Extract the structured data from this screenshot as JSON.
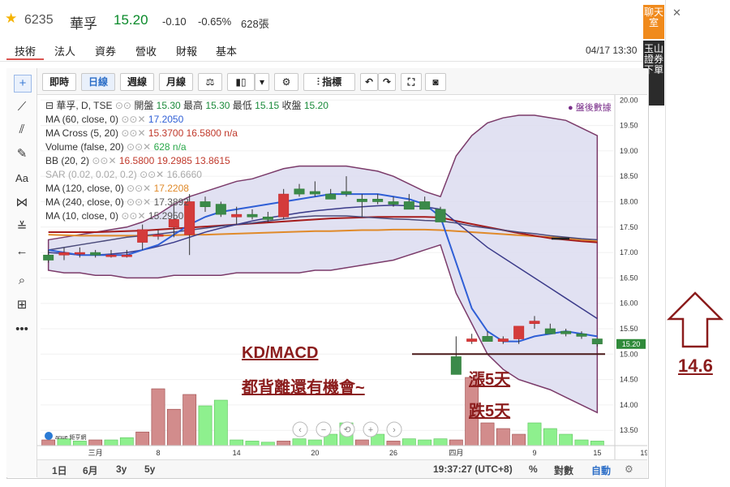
{
  "header": {
    "star_icon": "star-icon",
    "code": "6235",
    "name": "華孚",
    "price": "15.20",
    "change": "-0.10",
    "change_pct": "-0.65%",
    "volume": "628張",
    "datetime": "04/17 13:30",
    "tabs": [
      "技術",
      "法人",
      "資券",
      "營收",
      "財報",
      "基本"
    ]
  },
  "toolbar": {
    "intraday": "即時",
    "daily": "日線",
    "weekly": "週線",
    "monthly": "月線",
    "indicators": "指標"
  },
  "legend": {
    "title": "華孚, D, TSE",
    "open_label": "開盤",
    "open": "15.30",
    "high_label": "最高",
    "high": "15.30",
    "low_label": "最低",
    "low": "15.15",
    "close_label": "收盤",
    "close": "15.20",
    "after_hours": "● 盤後數據",
    "rows": [
      {
        "label": "MA (60, close, 0)",
        "values": "17.2050"
      },
      {
        "label": "MA Cross (5, 20)",
        "values": "15.3700  16.5800  n/a"
      },
      {
        "label": "Volume (false, 20)",
        "values": "628  n/a"
      },
      {
        "label": "BB (20, 2)",
        "values": "16.5800  19.2985  13.8615"
      },
      {
        "label": "SAR (0.02, 0.02, 0.2)",
        "values": "16.6660"
      },
      {
        "label": "MA (120, close, 0)",
        "values": "17.2208"
      },
      {
        "label": "MA (240, close, 0)",
        "values": "17.3892"
      },
      {
        "label": "MA (10, close, 0)",
        "values": "15.2950"
      }
    ]
  },
  "annotations": {
    "kd_macd": "KD/MACD",
    "divergence": "都背離還有機會~",
    "up5": "漲5天",
    "down5": "跌5天",
    "target": "14.6",
    "last_price_tag": "15.20",
    "nav_buttons": [
      "‹",
      "−",
      "⟲",
      "+",
      "›"
    ],
    "logo_text": "anue 鉅亨網"
  },
  "sidebar": {
    "chatroom": "聊天室",
    "trade": "玉山證券下單",
    "close": "✕"
  },
  "bottom_bar": {
    "ranges": [
      "1日",
      "6月",
      "3y",
      "5y"
    ],
    "time": "19:37:27 (UTC+8)",
    "percent": "%",
    "log": "對數",
    "auto": "自動"
  },
  "chart_data": {
    "type": "candlestick",
    "y_ticks": [
      13.5,
      14.0,
      14.5,
      15.0,
      15.5,
      16.0,
      16.5,
      17.0,
      17.5,
      18.0,
      18.5,
      19.0,
      19.5,
      20.0
    ],
    "ylim": [
      13.2,
      20.1
    ],
    "x_ticks": [
      "三月",
      "8",
      "14",
      "20",
      "26",
      "四月",
      "9",
      "15",
      "19"
    ],
    "candles": [
      {
        "o": 16.95,
        "h": 17.05,
        "l": 16.8,
        "c": 16.85
      },
      {
        "o": 16.95,
        "h": 17.1,
        "l": 16.85,
        "c": 17.0
      },
      {
        "o": 17.0,
        "h": 17.1,
        "l": 16.9,
        "c": 17.0
      },
      {
        "o": 17.0,
        "h": 17.05,
        "l": 16.9,
        "c": 16.95
      },
      {
        "o": 16.95,
        "h": 17.05,
        "l": 16.9,
        "c": 16.95
      },
      {
        "o": 16.95,
        "h": 17.05,
        "l": 16.9,
        "c": 16.95
      },
      {
        "o": 17.2,
        "h": 17.55,
        "l": 17.05,
        "c": 17.45
      },
      {
        "o": 17.35,
        "h": 17.45,
        "l": 17.25,
        "c": 17.35
      },
      {
        "o": 17.5,
        "h": 17.95,
        "l": 17.3,
        "c": 17.65
      },
      {
        "o": 17.35,
        "h": 18.15,
        "l": 16.95,
        "c": 18.0
      },
      {
        "o": 18.0,
        "h": 18.1,
        "l": 17.8,
        "c": 17.9
      },
      {
        "o": 17.95,
        "h": 18.0,
        "l": 17.7,
        "c": 17.75
      },
      {
        "o": 17.7,
        "h": 17.9,
        "l": 17.55,
        "c": 17.75
      },
      {
        "o": 17.75,
        "h": 17.85,
        "l": 17.65,
        "c": 17.7
      },
      {
        "o": 17.7,
        "h": 17.8,
        "l": 17.6,
        "c": 17.65
      },
      {
        "o": 17.7,
        "h": 18.25,
        "l": 17.65,
        "c": 18.15
      },
      {
        "o": 18.25,
        "h": 18.35,
        "l": 18.1,
        "c": 18.15
      },
      {
        "o": 18.2,
        "h": 18.4,
        "l": 18.1,
        "c": 18.15
      },
      {
        "o": 18.15,
        "h": 18.25,
        "l": 18.05,
        "c": 18.05
      },
      {
        "o": 18.2,
        "h": 18.5,
        "l": 18.1,
        "c": 18.15
      },
      {
        "o": 18.05,
        "h": 18.15,
        "l": 17.7,
        "c": 18.0
      },
      {
        "o": 18.05,
        "h": 18.15,
        "l": 17.95,
        "c": 18.0
      },
      {
        "o": 18.0,
        "h": 18.1,
        "l": 17.9,
        "c": 17.95
      },
      {
        "o": 18.0,
        "h": 18.15,
        "l": 17.9,
        "c": 17.85
      },
      {
        "o": 18.0,
        "h": 18.1,
        "l": 17.85,
        "c": 17.85
      },
      {
        "o": 17.85,
        "h": 17.9,
        "l": 17.6,
        "c": 17.6
      },
      {
        "o": 14.95,
        "h": 15.35,
        "l": 14.9,
        "c": 14.6
      },
      {
        "o": 15.25,
        "h": 15.4,
        "l": 15.2,
        "c": 15.3
      },
      {
        "o": 15.35,
        "h": 15.45,
        "l": 15.25,
        "c": 15.25
      },
      {
        "o": 15.25,
        "h": 15.35,
        "l": 15.2,
        "c": 15.3
      },
      {
        "o": 15.3,
        "h": 15.35,
        "l": 15.2,
        "c": 15.55
      },
      {
        "o": 15.6,
        "h": 15.75,
        "l": 15.5,
        "c": 15.65
      },
      {
        "o": 15.5,
        "h": 15.6,
        "l": 15.4,
        "c": 15.4
      },
      {
        "o": 15.45,
        "h": 15.5,
        "l": 15.35,
        "c": 15.4
      },
      {
        "o": 15.4,
        "h": 15.45,
        "l": 15.3,
        "c": 15.35
      },
      {
        "o": 15.3,
        "h": 15.3,
        "l": 15.15,
        "c": 15.2
      }
    ],
    "volume_levels": [
      0.05,
      0.06,
      0.04,
      0.05,
      0.05,
      0.07,
      0.12,
      0.5,
      0.32,
      0.45,
      0.35,
      0.4,
      0.05,
      0.04,
      0.03,
      0.04,
      0.06,
      0.05,
      0.1,
      0.2,
      0.05,
      0.1,
      0.04,
      0.06,
      0.05,
      0.06,
      0.05,
      0.6,
      0.2,
      0.15,
      0.1,
      0.2,
      0.15,
      0.1,
      0.05,
      0.04
    ],
    "volume_up": [
      false,
      true,
      true,
      false,
      true,
      true,
      false,
      false,
      false,
      false,
      true,
      true,
      true,
      true,
      true,
      false,
      true,
      true,
      true,
      true,
      false,
      true,
      false,
      true,
      true,
      true,
      false,
      false,
      false,
      false,
      false,
      true,
      true,
      true,
      true,
      true
    ],
    "bb_upper": [
      17.25,
      17.3,
      17.35,
      17.4,
      17.45,
      17.5,
      17.6,
      17.75,
      17.95,
      18.1,
      18.2,
      18.3,
      18.4,
      18.45,
      18.55,
      18.65,
      18.7,
      18.7,
      18.7,
      18.7,
      18.65,
      18.6,
      18.5,
      18.35,
      18.2,
      18.1,
      18.9,
      19.3,
      19.55,
      19.65,
      19.7,
      19.7,
      19.65,
      19.6,
      19.45,
      19.3
    ],
    "bb_lower": [
      16.65,
      16.6,
      16.6,
      16.55,
      16.55,
      16.5,
      16.5,
      16.5,
      16.55,
      16.55,
      16.55,
      16.55,
      16.6,
      16.6,
      16.6,
      16.6,
      16.6,
      16.65,
      16.65,
      16.7,
      16.75,
      16.8,
      16.85,
      16.95,
      17.05,
      17.15,
      16.2,
      15.6,
      15.0,
      14.7,
      14.5,
      14.4,
      14.3,
      14.15,
      14.0,
      13.85
    ],
    "ma_fast": [
      17.05,
      17.0,
      16.95,
      16.95,
      16.95,
      16.95,
      17.05,
      17.15,
      17.35,
      17.55,
      17.7,
      17.8,
      17.85,
      17.9,
      17.95,
      18.0,
      18.05,
      18.1,
      18.15,
      18.15,
      18.15,
      18.15,
      18.1,
      18.05,
      17.95,
      17.7,
      16.8,
      15.9,
      15.45,
      15.25,
      15.25,
      15.35,
      15.4,
      15.45,
      15.4,
      15.35
    ],
    "ma_mid": [
      17.0,
      16.98,
      16.95,
      16.95,
      16.97,
      17.0,
      17.05,
      17.12,
      17.2,
      17.3,
      17.4,
      17.48,
      17.55,
      17.62,
      17.68,
      17.73,
      17.78,
      17.82,
      17.85,
      17.88,
      17.9,
      17.92,
      17.93,
      17.92,
      17.9,
      17.85,
      17.6,
      17.35,
      17.1,
      16.9,
      16.7,
      16.5,
      16.3,
      16.1,
      15.9,
      15.7
    ],
    "ma_slow": [
      17.4,
      17.4,
      17.4,
      17.4,
      17.41,
      17.42,
      17.43,
      17.45,
      17.47,
      17.49,
      17.51,
      17.53,
      17.55,
      17.57,
      17.59,
      17.61,
      17.63,
      17.65,
      17.67,
      17.68,
      17.69,
      17.7,
      17.7,
      17.7,
      17.7,
      17.69,
      17.62,
      17.56,
      17.5,
      17.44,
      17.38,
      17.33,
      17.28,
      17.25,
      17.22,
      17.2
    ],
    "ma_long": [
      17.35,
      17.34,
      17.33,
      17.33,
      17.33,
      17.33,
      17.33,
      17.33,
      17.34,
      17.35,
      17.35,
      17.36,
      17.37,
      17.38,
      17.39,
      17.4,
      17.41,
      17.42,
      17.42,
      17.43,
      17.44,
      17.44,
      17.45,
      17.45,
      17.45,
      17.44,
      17.42,
      17.4,
      17.38,
      17.36,
      17.34,
      17.32,
      17.3,
      17.28,
      17.25,
      17.22
    ],
    "ma_grey": [
      17.05,
      17.1,
      17.15,
      17.2,
      17.25,
      17.3,
      17.33,
      17.36,
      17.4,
      17.44,
      17.48,
      17.52,
      17.55,
      17.58,
      17.62,
      17.66,
      17.7,
      17.72,
      17.72,
      17.72,
      17.7,
      17.68,
      17.66,
      17.65,
      17.63,
      17.62,
      17.58,
      17.52,
      17.48,
      17.44,
      17.4,
      17.37,
      17.33,
      17.3,
      17.27,
      17.25
    ],
    "support_line": 15.0
  }
}
